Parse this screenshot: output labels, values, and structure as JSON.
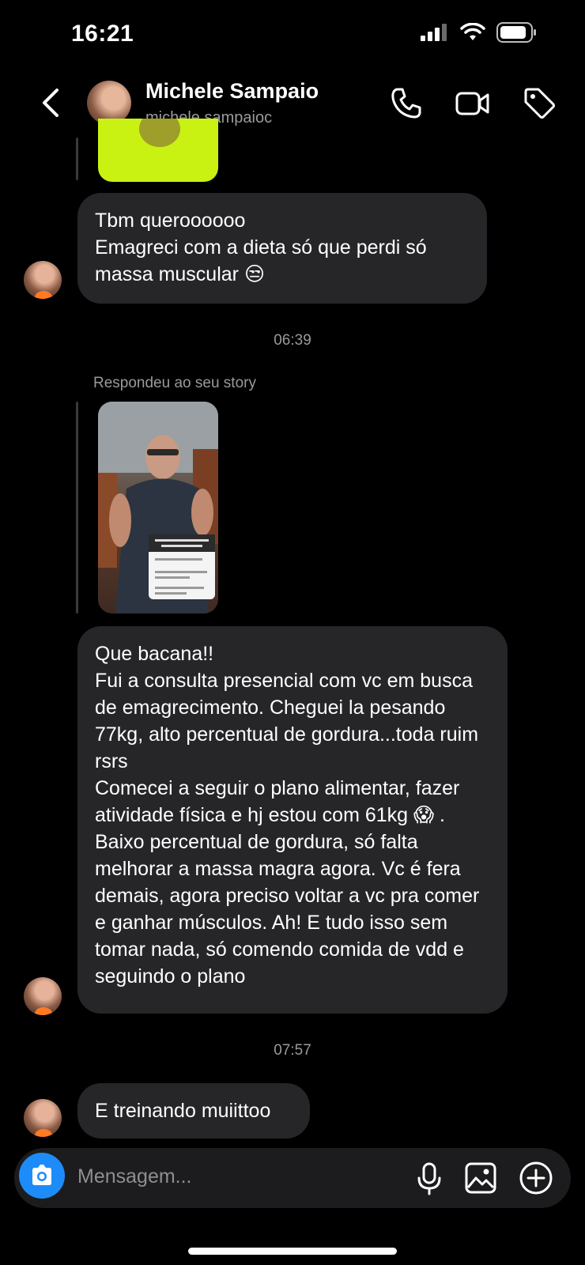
{
  "status_bar": {
    "time": "16:21"
  },
  "header": {
    "name": "Michele Sampaio",
    "username": "michele.sampaioc",
    "back_icon": "chevron-left-icon",
    "call_icon": "phone-icon",
    "video_icon": "video-camera-icon",
    "tag_icon": "tag-icon"
  },
  "messages": {
    "msg1": {
      "lines": [
        "Tbm queroooooo",
        "Emagreci com a dieta só que perdi só massa muscular 😒"
      ]
    },
    "timestamp1": "06:39",
    "story_reply_label": "Respondeu ao seu story",
    "msg2": {
      "paragraphs": [
        "Que bacana!!",
        "Fui a consulta presencial com vc em busca de emagrecimento. Cheguei la pesando 77kg, alto percentual de gordura...toda ruim rsrs",
        "Comecei a seguir o plano alimentar, fazer atividade física e hj estou com 61kg 😱 . Baixo percentual de gordura, só falta melhorar a massa magra agora. Vc é fera demais, agora preciso voltar a vc pra comer e ganhar músculos.  Ah! E tudo isso sem tomar nada, só comendo comida de vdd e seguindo o plano"
      ]
    },
    "timestamp2": "07:57",
    "msg3": {
      "text": "E treinando muiittoo"
    }
  },
  "composer": {
    "placeholder": "Mensagem...",
    "camera_icon": "camera-icon",
    "mic_icon": "microphone-icon",
    "gallery_icon": "image-icon",
    "add_icon": "plus-circle-icon"
  },
  "colors": {
    "background": "#000000",
    "bubble": "#262628",
    "accent_blue": "#1d8cf8",
    "muted_text": "#9a9a9a"
  }
}
